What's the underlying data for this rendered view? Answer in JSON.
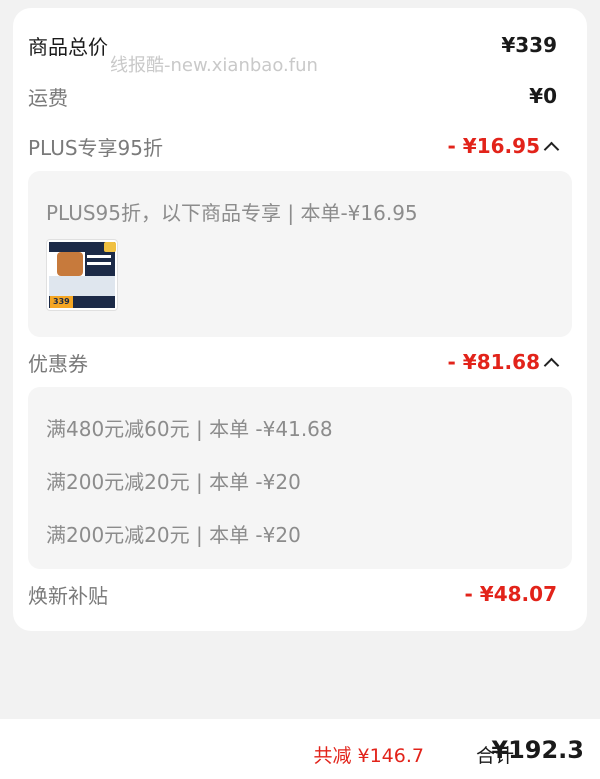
{
  "watermark": "线报酷-new.xianbao.fun",
  "summary": {
    "goods_total_label": "商品总价",
    "goods_total_value": "¥339",
    "shipping_label": "运费",
    "shipping_value": "¥0",
    "plus_label": "PLUS专享95折",
    "plus_value": "- ¥16.95",
    "coupon_label": "优惠券",
    "coupon_value": "- ¥81.68",
    "subsidy_label": "焕新补贴",
    "subsidy_value": "- ¥48.07"
  },
  "plus_panel": {
    "description": "PLUS95折，以下商品专享 | 本单-¥16.95",
    "product_price_tag": "339"
  },
  "coupon_panel": {
    "items": [
      "满480元减60元 | 本单 -¥41.68",
      "满200元减20元 | 本单 -¥20",
      "满200元减20元 | 本单 -¥20"
    ]
  },
  "footer": {
    "saved_text": "共减 ¥146.7",
    "total_label": "合计",
    "total_value": "¥192.3"
  },
  "colors": {
    "accent_red": "#e2231a",
    "background": "#f2f2f2",
    "panel": "#f5f5f5"
  }
}
